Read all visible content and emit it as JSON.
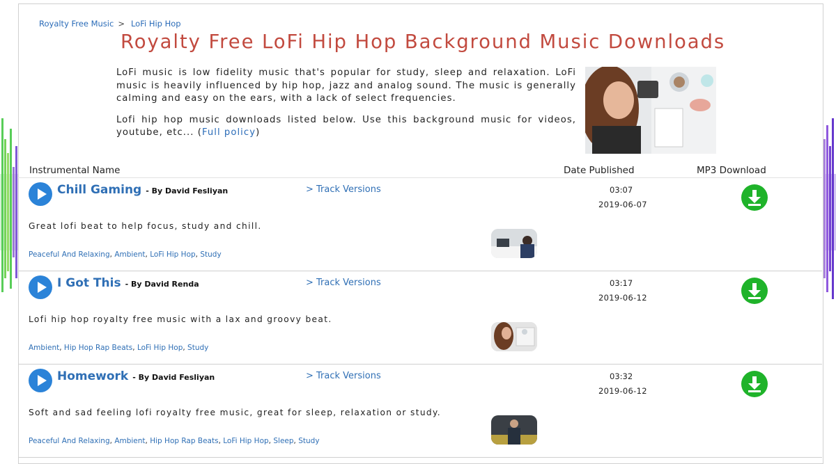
{
  "breadcrumb": {
    "home_label": "Royalty Free Music",
    "separator": ">",
    "current_label": "LoFi Hip Hop"
  },
  "page": {
    "title": "Royalty Free LoFi Hip Hop Background Music Downloads",
    "intro_paragraph_1": "LoFi music is low fidelity music that's popular for study, sleep and relaxation. LoFi music is heavily influenced by hip hop, jazz and analog sound. The music is generally calming and easy on the ears, with a lack of select frequencies.",
    "intro_paragraph_2_prefix": "Lofi hip hop music downloads listed below. Use this background music for videos, youtube, etc... (",
    "policy_link": "Full policy",
    "intro_paragraph_2_suffix": ")"
  },
  "table_headers": {
    "name": "Instrumental Name",
    "date": "Date Published",
    "download": "MP3 Download"
  },
  "tracks": [
    {
      "title": "Chill Gaming",
      "by": "- By David Fesliyan",
      "versions_label": "> Track Versions",
      "duration": "03:07",
      "date": "2019-06-07",
      "description": "Great lofi beat to help focus, study and chill.",
      "tags": [
        "Peaceful And Relaxing",
        "Ambient",
        "LoFi Hip Hop",
        "Study"
      ]
    },
    {
      "title": "I Got This",
      "by": "- By David Renda",
      "versions_label": "> Track Versions",
      "duration": "03:17",
      "date": "2019-06-12",
      "description": "Lofi hip hop royalty free music with a lax and groovy beat.",
      "tags": [
        "Ambient",
        "Hip Hop Rap Beats",
        "LoFi Hip Hop",
        "Study"
      ]
    },
    {
      "title": "Homework",
      "by": "- By David Fesliyan",
      "versions_label": "> Track Versions",
      "duration": "03:32",
      "date": "2019-06-12",
      "description": "Soft and sad feeling lofi royalty free music, great for sleep, relaxation or study.",
      "tags": [
        "Peaceful And Relaxing",
        "Ambient",
        "Hip Hop Rap Beats",
        "LoFi Hip Hop",
        "Sleep",
        "Study"
      ]
    }
  ],
  "icons": {
    "play": "play-icon",
    "download": "download-icon"
  },
  "colors": {
    "title_red": "#c24a3f",
    "link_blue": "#2f6fb5",
    "play_blue": "#2b83d8",
    "download_green": "#1fb32a"
  }
}
